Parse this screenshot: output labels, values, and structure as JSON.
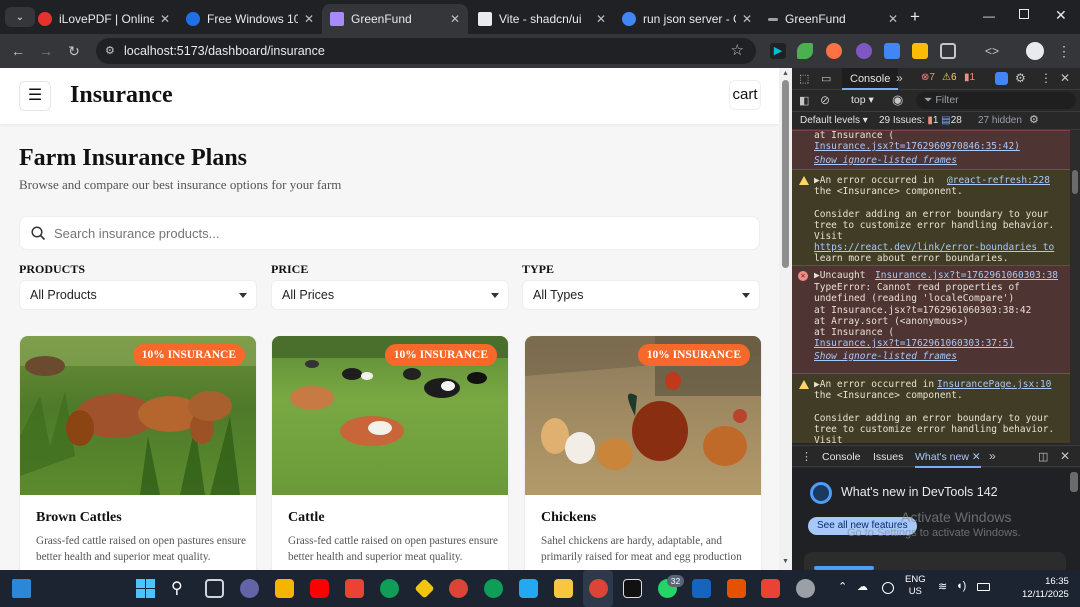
{
  "browser": {
    "tabs": [
      {
        "title": "iLovePDF | Online PDF",
        "active": false,
        "color": "#e5322d"
      },
      {
        "title": "Free Windows 10 & Office",
        "active": false,
        "color": "#1f6feb"
      },
      {
        "title": "GreenFund",
        "active": true,
        "color": "#a78bfa"
      },
      {
        "title": "Vite - shadcn/ui",
        "active": false,
        "color": "#e8eaed"
      },
      {
        "title": "run json server - Goo",
        "active": false,
        "color": "#4285f4"
      },
      {
        "title": "GreenFund",
        "active": false,
        "color": "#9aa0a6"
      }
    ],
    "url": "localhost:5173/dashboard/insurance"
  },
  "app": {
    "header_title": "Insurance",
    "cart_label": "cart",
    "menu_icon": "☰",
    "heading": "Farm Insurance Plans",
    "subheading": "Browse and compare our best insurance options for your farm",
    "search_placeholder": "Search insurance products...",
    "filters": [
      {
        "label": "PRODUCTS",
        "value": "All Products"
      },
      {
        "label": "PRICE",
        "value": "All Prices"
      },
      {
        "label": "TYPE",
        "value": "All Types"
      }
    ],
    "cards": [
      {
        "badge": "10% INSURANCE",
        "title": "Brown Cattles",
        "desc": "Grass-fed cattle raised on open pastures ensure better health and superior meat quality."
      },
      {
        "badge": "10% INSURANCE",
        "title": "Cattle",
        "desc": "Grass-fed cattle raised on open pastures ensure better health and superior meat quality."
      },
      {
        "badge": "10% INSURANCE",
        "title": "Chickens",
        "desc": "Sahel chickens are hardy, adaptable, and primarily raised for meat and egg production"
      }
    ]
  },
  "devtools": {
    "tabs": [
      "Console"
    ],
    "badges": {
      "errors": "7",
      "warnings": "6",
      "info": "1"
    },
    "context": "top",
    "filter_placeholder": "Filter",
    "levels_label": "Default levels",
    "issues_label": "29 Issues:",
    "issues_errors": "1",
    "issues_info": "28",
    "hidden_label": "27 hidden",
    "messages": [
      {
        "kind": "err",
        "lines": [
          "    at Insurance (",
          "Insurance.jsx?t=1762960970846:35:42)",
          "  Show ignore-listed frames"
        ]
      },
      {
        "kind": "warn",
        "source": "@react-refresh:228",
        "lines": [
          "▶An error occurred in",
          "the <Insurance> component.",
          "",
          "Consider adding an error boundary to your",
          "tree to customize error handling behavior.",
          "Visit",
          "https://react.dev/link/error-boundaries to",
          "learn more about error boundaries."
        ]
      },
      {
        "kind": "err",
        "source": "Insurance.jsx?t=1762961060303:38",
        "lines": [
          "▶Uncaught",
          "TypeError: Cannot read properties of",
          "undefined (reading 'localeCompare')",
          "    at Insurance.jsx?t=1762961060303:38:42",
          "    at Array.sort (<anonymous>)",
          "    at Insurance (",
          "Insurance.jsx?t=1762961060303:37:5)",
          "  Show ignore-listed frames"
        ]
      },
      {
        "kind": "warn",
        "source": "InsurancePage.jsx:10",
        "lines": [
          "▶An error occurred in",
          "the <Insurance> component.",
          "",
          "Consider adding an error boundary to your",
          "tree to customize error handling behavior.",
          "Visit"
        ]
      }
    ],
    "drawer_tabs": [
      "Console",
      "Issues",
      "What's new"
    ],
    "whats_new_title": "What's new in DevTools 142",
    "whats_new_button": "See all new features",
    "activate_title": "Activate Windows",
    "activate_sub": "Go to Settings to activate Windows."
  },
  "taskbar": {
    "lang": "ENG",
    "region": "US",
    "time": "16:35",
    "date": "12/11/2025",
    "whatsapp_badge": "32"
  }
}
